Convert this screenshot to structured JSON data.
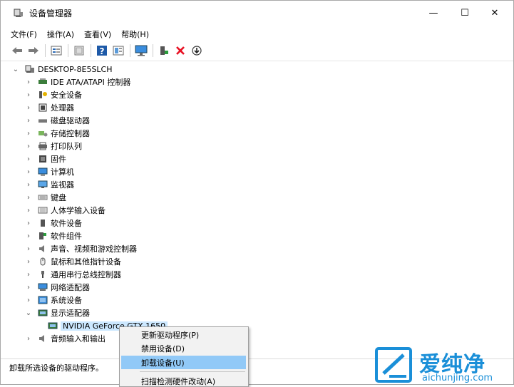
{
  "window": {
    "title": "设备管理器",
    "minimize_glyph": "—",
    "maximize_glyph": "☐",
    "close_glyph": "✕"
  },
  "menubar": {
    "items": [
      "文件(F)",
      "操作(A)",
      "查看(V)",
      "帮助(H)"
    ]
  },
  "toolbar": {
    "icons": [
      "back-arrow-icon",
      "forward-arrow-icon",
      "properties-grid-icon",
      "show-hidden-icon",
      "help-icon",
      "view-resources-icon",
      "monitor-scan-icon",
      "add-driver-icon",
      "uninstall-x-icon",
      "update-driver-icon"
    ]
  },
  "tree": {
    "root": "DESKTOP-8E5SLCH",
    "items": [
      {
        "label": "IDE ATA/ATAPI 控制器",
        "icon": "ide-controller-icon"
      },
      {
        "label": "安全设备",
        "icon": "security-key-icon"
      },
      {
        "label": "处理器",
        "icon": "processor-icon"
      },
      {
        "label": "磁盘驱动器",
        "icon": "disk-drive-icon"
      },
      {
        "label": "存储控制器",
        "icon": "storage-controller-icon"
      },
      {
        "label": "打印队列",
        "icon": "printer-icon"
      },
      {
        "label": "固件",
        "icon": "firmware-icon"
      },
      {
        "label": "计算机",
        "icon": "computer-icon"
      },
      {
        "label": "监视器",
        "icon": "monitor-icon"
      },
      {
        "label": "键盘",
        "icon": "keyboard-icon"
      },
      {
        "label": "人体学输入设备",
        "icon": "hid-icon"
      },
      {
        "label": "软件设备",
        "icon": "software-device-icon"
      },
      {
        "label": "软件组件",
        "icon": "software-component-icon"
      },
      {
        "label": "声音、视频和游戏控制器",
        "icon": "speaker-icon"
      },
      {
        "label": "鼠标和其他指针设备",
        "icon": "mouse-icon"
      },
      {
        "label": "通用串行总线控制器",
        "icon": "usb-icon"
      },
      {
        "label": "网络适配器",
        "icon": "network-adapter-icon"
      },
      {
        "label": "系统设备",
        "icon": "system-device-icon"
      },
      {
        "label": "显示适配器",
        "icon": "display-adapter-icon",
        "expanded": true
      },
      {
        "label": "音频输入和输出",
        "icon": "audio-io-icon"
      }
    ],
    "child": {
      "label": "NVIDIA GeForce GTX 1650",
      "icon": "gpu-icon"
    }
  },
  "context_menu": {
    "items": [
      "更新驱动程序(P)",
      "禁用设备(D)",
      "卸载设备(U)",
      "扫描检测硬件改动(A)"
    ],
    "highlighted_index": 2
  },
  "status": {
    "text": "卸载所选设备的驱动程序。"
  },
  "watermark": {
    "brand": "爱纯净",
    "url": "aichunjing.com"
  },
  "colors": {
    "selection": "#cce8ff",
    "menu_highlight": "#91c9f7",
    "uninstall_red": "#e81123",
    "watermark_blue": "#1a8fd8"
  }
}
